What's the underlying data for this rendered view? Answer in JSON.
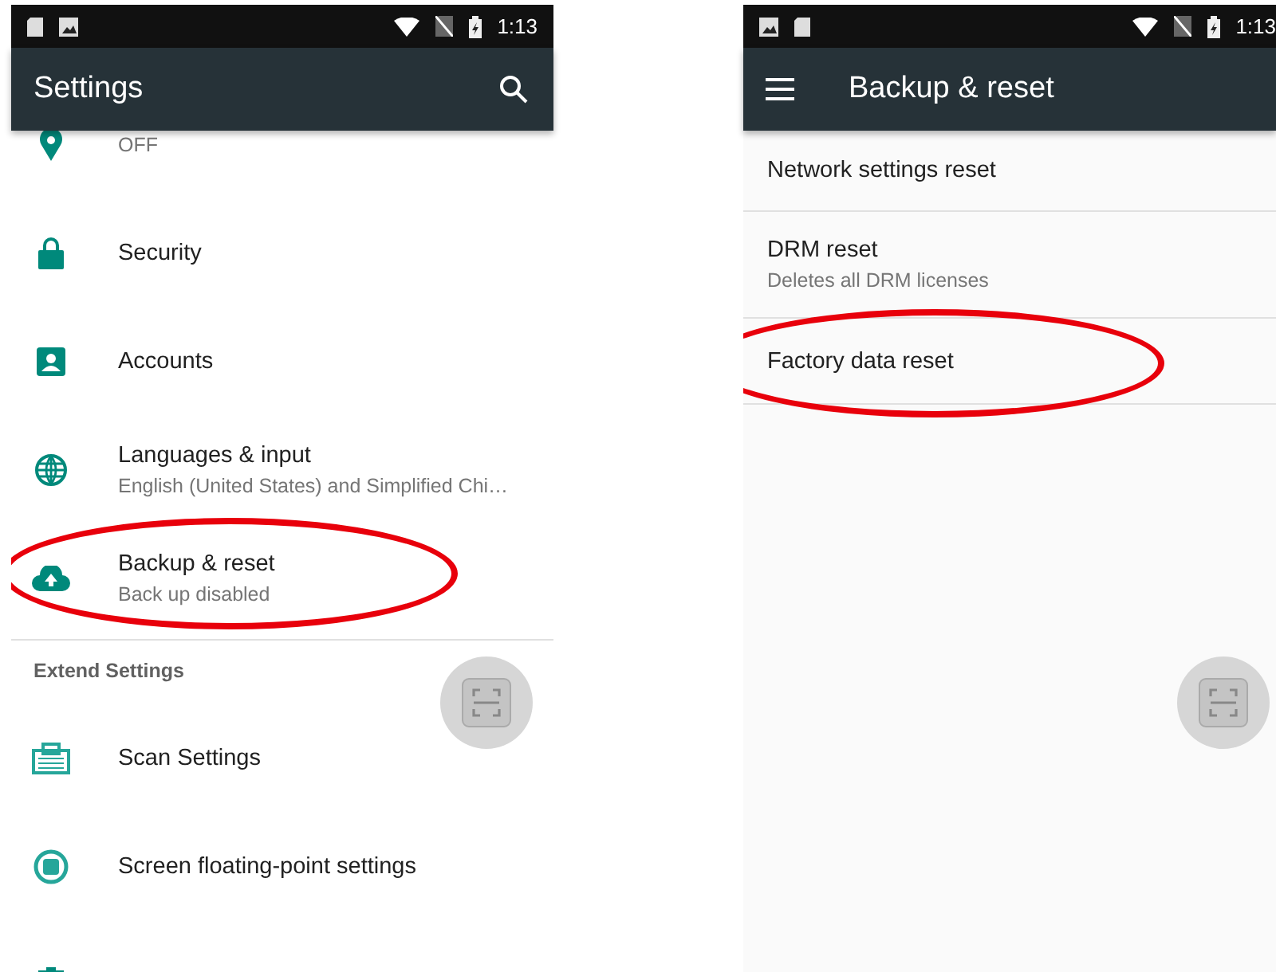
{
  "settings_screen": {
    "status_bar": {
      "time": "1:13"
    },
    "title": "Settings",
    "items": [
      {
        "kind": "item",
        "subtitle": "OFF",
        "circled": false
      },
      {
        "kind": "item",
        "title": "Security",
        "circled": false
      },
      {
        "kind": "item",
        "title": "Accounts",
        "circled": false
      },
      {
        "kind": "item",
        "title": "Languages & input",
        "subtitle": "English (United States) and Simplified Chi…",
        "circled": false
      },
      {
        "kind": "item",
        "title": "Backup & reset",
        "subtitle": "Back up disabled",
        "circled": true
      },
      {
        "kind": "header",
        "title": "Extend Settings"
      },
      {
        "kind": "item",
        "title": "Scan Settings",
        "circled": false
      },
      {
        "kind": "item",
        "title": "Screen floating-point settings",
        "circled": false
      },
      {
        "kind": "item",
        "circled": false
      }
    ]
  },
  "backup_screen": {
    "status_bar": {
      "time": "1:13"
    },
    "title": "Backup & reset",
    "items": [
      {
        "title": "Network settings reset",
        "circled": false
      },
      {
        "title": "DRM reset",
        "subtitle": "Deletes all DRM licenses",
        "circled": false
      },
      {
        "title": "Factory data reset",
        "circled": true
      }
    ]
  }
}
